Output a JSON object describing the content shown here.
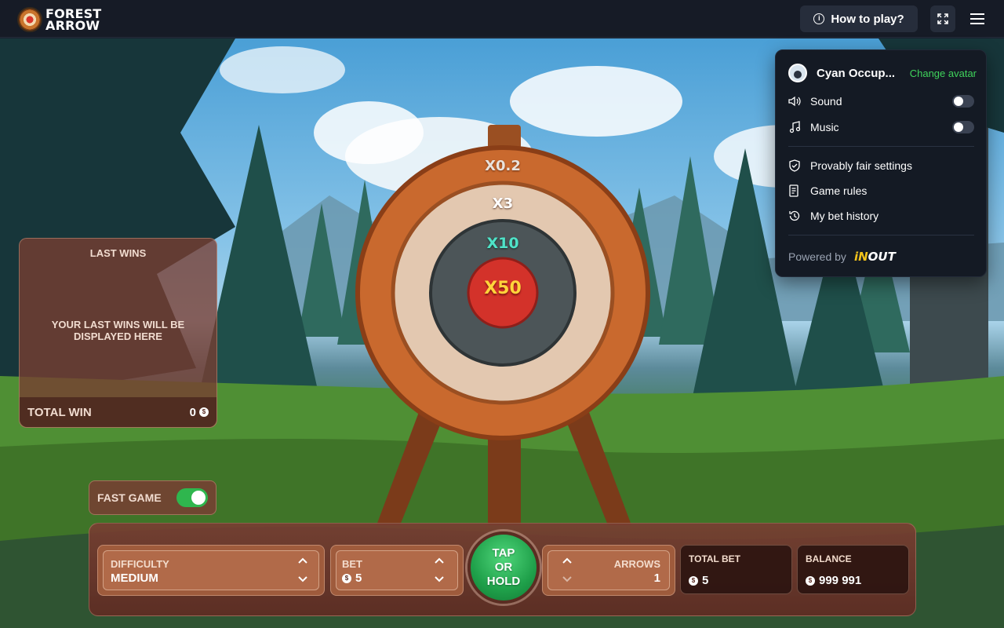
{
  "app": {
    "logo_line1": "FOREST",
    "logo_line2": "ARROW"
  },
  "header": {
    "how_to_play": "How to play?",
    "info_icon": "info-icon",
    "fullscreen_icon": "fullscreen-icon",
    "menu_icon": "hamburger-menu-icon"
  },
  "target": {
    "rings": [
      "X0.2",
      "X3",
      "X10",
      "X50"
    ]
  },
  "last_wins": {
    "title": "LAST WINS",
    "empty_message": "YOUR LAST WINS WILL BE DISPLAYED HERE",
    "total_win_label": "TOTAL WIN",
    "total_win_value": "0"
  },
  "fast_game": {
    "label": "FAST GAME",
    "enabled": true
  },
  "controls": {
    "difficulty_label": "DIFFICULTY",
    "difficulty_value": "MEDIUM",
    "bet_label": "BET",
    "bet_value": "5",
    "tap_line1": "TAP",
    "tap_line2": "OR",
    "tap_line3": "HOLD",
    "arrows_label": "ARROWS",
    "arrows_value": "1",
    "total_bet_label": "TOTAL BET",
    "total_bet_value": "5",
    "balance_label": "BALANCE",
    "balance_value": "999 991"
  },
  "menu": {
    "username": "Cyan Occup...",
    "change_avatar": "Change avatar",
    "sound_label": "Sound",
    "sound_on": false,
    "music_label": "Music",
    "music_on": false,
    "provably_fair": "Provably fair settings",
    "game_rules": "Game rules",
    "bet_history": "My bet history",
    "powered_by": "Powered by",
    "brand_in": "iN",
    "brand_out": "OUT"
  },
  "colors": {
    "accent_green": "#3fd35b",
    "panel_brown": "#7a3e32",
    "menu_bg": "#141a24",
    "topbar_bg": "#161b26"
  }
}
